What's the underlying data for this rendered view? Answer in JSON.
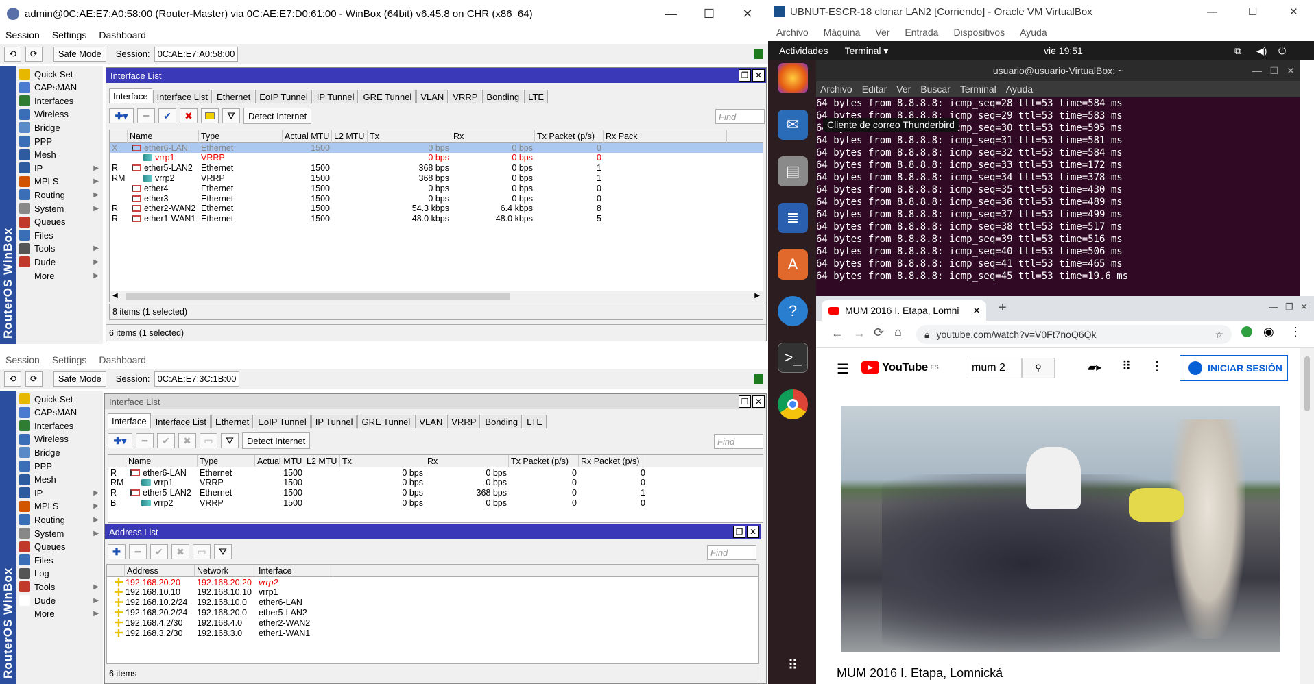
{
  "top_window": {
    "title": "admin@0C:AE:E7:A0:58:00 (Router-Master) via 0C:AE:E7:D0:61:00 - WinBox (64bit) v6.45.8 on CHR (x86_64)",
    "menu": [
      "Session",
      "Settings",
      "Dashboard"
    ],
    "safe_mode": "Safe Mode",
    "session_label": "Session:",
    "session_value": "0C:AE:E7:A0:58:00"
  },
  "bottom_window": {
    "menu": [
      "Session",
      "Settings",
      "Dashboard"
    ],
    "safe_mode": "Safe Mode",
    "session_label": "Session:",
    "session_value": "0C:AE:E7:3C:1B:00"
  },
  "sidebar_brand": "RouterOS WinBox",
  "sidebar_top": [
    "Quick Set",
    "CAPsMAN",
    "Interfaces",
    "Wireless",
    "Bridge",
    "PPP",
    "Mesh",
    "IP",
    "MPLS",
    "Routing",
    "System",
    "Queues",
    "Files",
    "Tools",
    "Dude",
    "More"
  ],
  "sidebar_bottom": [
    "Quick Set",
    "CAPsMAN",
    "Interfaces",
    "Wireless",
    "Bridge",
    "PPP",
    "Mesh",
    "IP",
    "MPLS",
    "Routing",
    "System",
    "Queues",
    "Files",
    "Log",
    "Tools",
    "Dude",
    "More"
  ],
  "iface_panel": {
    "title": "Interface List",
    "tabs": [
      "Interface",
      "Interface List",
      "Ethernet",
      "EoIP Tunnel",
      "IP Tunnel",
      "GRE Tunnel",
      "VLAN",
      "VRRP",
      "Bonding",
      "LTE"
    ],
    "detect": "Detect Internet",
    "find": "Find",
    "columns": [
      "Name",
      "Type",
      "Actual MTU",
      "L2 MTU",
      "Tx",
      "Rx",
      "Tx Packet (p/s)",
      "Rx Pack"
    ],
    "rows": [
      {
        "flag": "X",
        "name": "ether6-LAN",
        "type": "Ethernet",
        "mtu": "1500",
        "l2": "",
        "tx": "0 bps",
        "rx": "0 bps",
        "txp": "0",
        "kind": "eth",
        "style": "sel"
      },
      {
        "flag": "",
        "name": "vrrp1",
        "type": "VRRP",
        "mtu": "",
        "l2": "",
        "tx": "0 bps",
        "rx": "0 bps",
        "txp": "0",
        "kind": "vrrp",
        "style": "red"
      },
      {
        "flag": "R",
        "name": "ether5-LAN2",
        "type": "Ethernet",
        "mtu": "1500",
        "l2": "",
        "tx": "368 bps",
        "rx": "0 bps",
        "txp": "1",
        "kind": "eth",
        "style": ""
      },
      {
        "flag": "RM",
        "name": "vrrp2",
        "type": "VRRP",
        "mtu": "1500",
        "l2": "",
        "tx": "368 bps",
        "rx": "0 bps",
        "txp": "1",
        "kind": "vrrp",
        "style": ""
      },
      {
        "flag": "",
        "name": "ether4",
        "type": "Ethernet",
        "mtu": "1500",
        "l2": "",
        "tx": "0 bps",
        "rx": "0 bps",
        "txp": "0",
        "kind": "eth",
        "style": ""
      },
      {
        "flag": "",
        "name": "ether3",
        "type": "Ethernet",
        "mtu": "1500",
        "l2": "",
        "tx": "0 bps",
        "rx": "0 bps",
        "txp": "0",
        "kind": "eth",
        "style": ""
      },
      {
        "flag": "R",
        "name": "ether2-WAN2",
        "type": "Ethernet",
        "mtu": "1500",
        "l2": "",
        "tx": "54.3 kbps",
        "rx": "6.4 kbps",
        "txp": "8",
        "kind": "eth",
        "style": ""
      },
      {
        "flag": "R",
        "name": "ether1-WAN1",
        "type": "Ethernet",
        "mtu": "1500",
        "l2": "",
        "tx": "48.0 kbps",
        "rx": "48.0 kbps",
        "txp": "5",
        "kind": "eth",
        "style": ""
      }
    ],
    "status": "8 items (1 selected)",
    "outer_status": "6 items (1 selected)"
  },
  "iface_panel2": {
    "title": "Interface List",
    "tabs": [
      "Interface",
      "Interface List",
      "Ethernet",
      "EoIP Tunnel",
      "IP Tunnel",
      "GRE Tunnel",
      "VLAN",
      "VRRP",
      "Bonding",
      "LTE"
    ],
    "detect": "Detect Internet",
    "find": "Find",
    "columns": [
      "Name",
      "Type",
      "Actual MTU",
      "L2 MTU",
      "Tx",
      "Rx",
      "Tx Packet (p/s)",
      "Rx Packet (p/s)"
    ],
    "rows": [
      {
        "flag": "R",
        "name": "ether6-LAN",
        "type": "Ethernet",
        "mtu": "1500",
        "tx": "0 bps",
        "rx": "0 bps",
        "txp": "0",
        "rxp": "0",
        "kind": "eth"
      },
      {
        "flag": "RM",
        "name": "vrrp1",
        "type": "VRRP",
        "mtu": "1500",
        "tx": "0 bps",
        "rx": "0 bps",
        "txp": "0",
        "rxp": "0",
        "kind": "vrrp"
      },
      {
        "flag": "R",
        "name": "ether5-LAN2",
        "type": "Ethernet",
        "mtu": "1500",
        "tx": "0 bps",
        "rx": "368 bps",
        "txp": "0",
        "rxp": "1",
        "kind": "eth"
      },
      {
        "flag": "B",
        "name": "vrrp2",
        "type": "VRRP",
        "mtu": "1500",
        "tx": "0 bps",
        "rx": "0 bps",
        "txp": "0",
        "rxp": "0",
        "kind": "vrrp"
      }
    ]
  },
  "addr_panel": {
    "title": "Address List",
    "find": "Find",
    "columns": [
      "Address",
      "Network",
      "Interface"
    ],
    "rows": [
      {
        "address": "192.168.20.20",
        "network": "192.168.20.20",
        "iface": "vrrp2",
        "style": "red"
      },
      {
        "address": "192.168.10.10",
        "network": "192.168.10.10",
        "iface": "vrrp1",
        "style": ""
      },
      {
        "address": "192.168.10.2/24",
        "network": "192.168.10.0",
        "iface": "ether6-LAN",
        "style": ""
      },
      {
        "address": "192.168.20.2/24",
        "network": "192.168.20.0",
        "iface": "ether5-LAN2",
        "style": ""
      },
      {
        "address": "192.168.4.2/30",
        "network": "192.168.4.0",
        "iface": "ether2-WAN2",
        "style": ""
      },
      {
        "address": "192.168.3.2/30",
        "network": "192.168.3.0",
        "iface": "ether1-WAN1",
        "style": ""
      }
    ],
    "status": "6 items"
  },
  "vbox": {
    "title": "UBNUT-ESCR-18 clonar LAN2 [Corriendo] - Oracle VM VirtualBox",
    "menu": [
      "Archivo",
      "Máquina",
      "Ver",
      "Entrada",
      "Dispositivos",
      "Ayuda"
    ]
  },
  "gnome": {
    "activities": "Actividades",
    "app": "Terminal",
    "clock": "vie 19:51"
  },
  "terminal": {
    "title": "usuario@usuario-VirtualBox: ~",
    "menu": [
      "Archivo",
      "Editar",
      "Ver",
      "Buscar",
      "Terminal",
      "Ayuda"
    ],
    "lines": [
      "64 bytes from 8.8.8.8: icmp_seq=28 ttl=53 time=584 ms",
      "64 bytes from 8.8.8.8: icmp_seq=29 ttl=53 time=583 ms",
      "64 bytes from 8.8.8.8: icmp_seq=30 ttl=53 time=595 ms",
      "64 bytes from 8.8.8.8: icmp_seq=31 ttl=53 time=581 ms",
      "64 bytes from 8.8.8.8: icmp_seq=32 ttl=53 time=584 ms",
      "64 bytes from 8.8.8.8: icmp_seq=33 ttl=53 time=172 ms",
      "64 bytes from 8.8.8.8: icmp_seq=34 ttl=53 time=378 ms",
      "64 bytes from 8.8.8.8: icmp_seq=35 ttl=53 time=430 ms",
      "64 bytes from 8.8.8.8: icmp_seq=36 ttl=53 time=489 ms",
      "64 bytes from 8.8.8.8: icmp_seq=37 ttl=53 time=499 ms",
      "64 bytes from 8.8.8.8: icmp_seq=38 ttl=53 time=517 ms",
      "64 bytes from 8.8.8.8: icmp_seq=39 ttl=53 time=516 ms",
      "64 bytes from 8.8.8.8: icmp_seq=40 ttl=53 time=506 ms",
      "64 bytes from 8.8.8.8: icmp_seq=41 ttl=53 time=465 ms",
      "64 bytes from 8.8.8.8: icmp_seq=45 ttl=53 time=19.6 ms"
    ]
  },
  "tooltip": "Cliente de correo Thunderbird",
  "chrome": {
    "tab_title": "MUM 2016 I. Etapa, Lomni",
    "url": "youtube.com/watch?v=V0Ft7noQ6Qk",
    "search_value": "mum 2",
    "logo": "YouTube",
    "logo_sup": "ES",
    "signin": "INICIAR SESIÓN",
    "video_title": "MUM 2016 I. Etapa, Lomnická"
  }
}
